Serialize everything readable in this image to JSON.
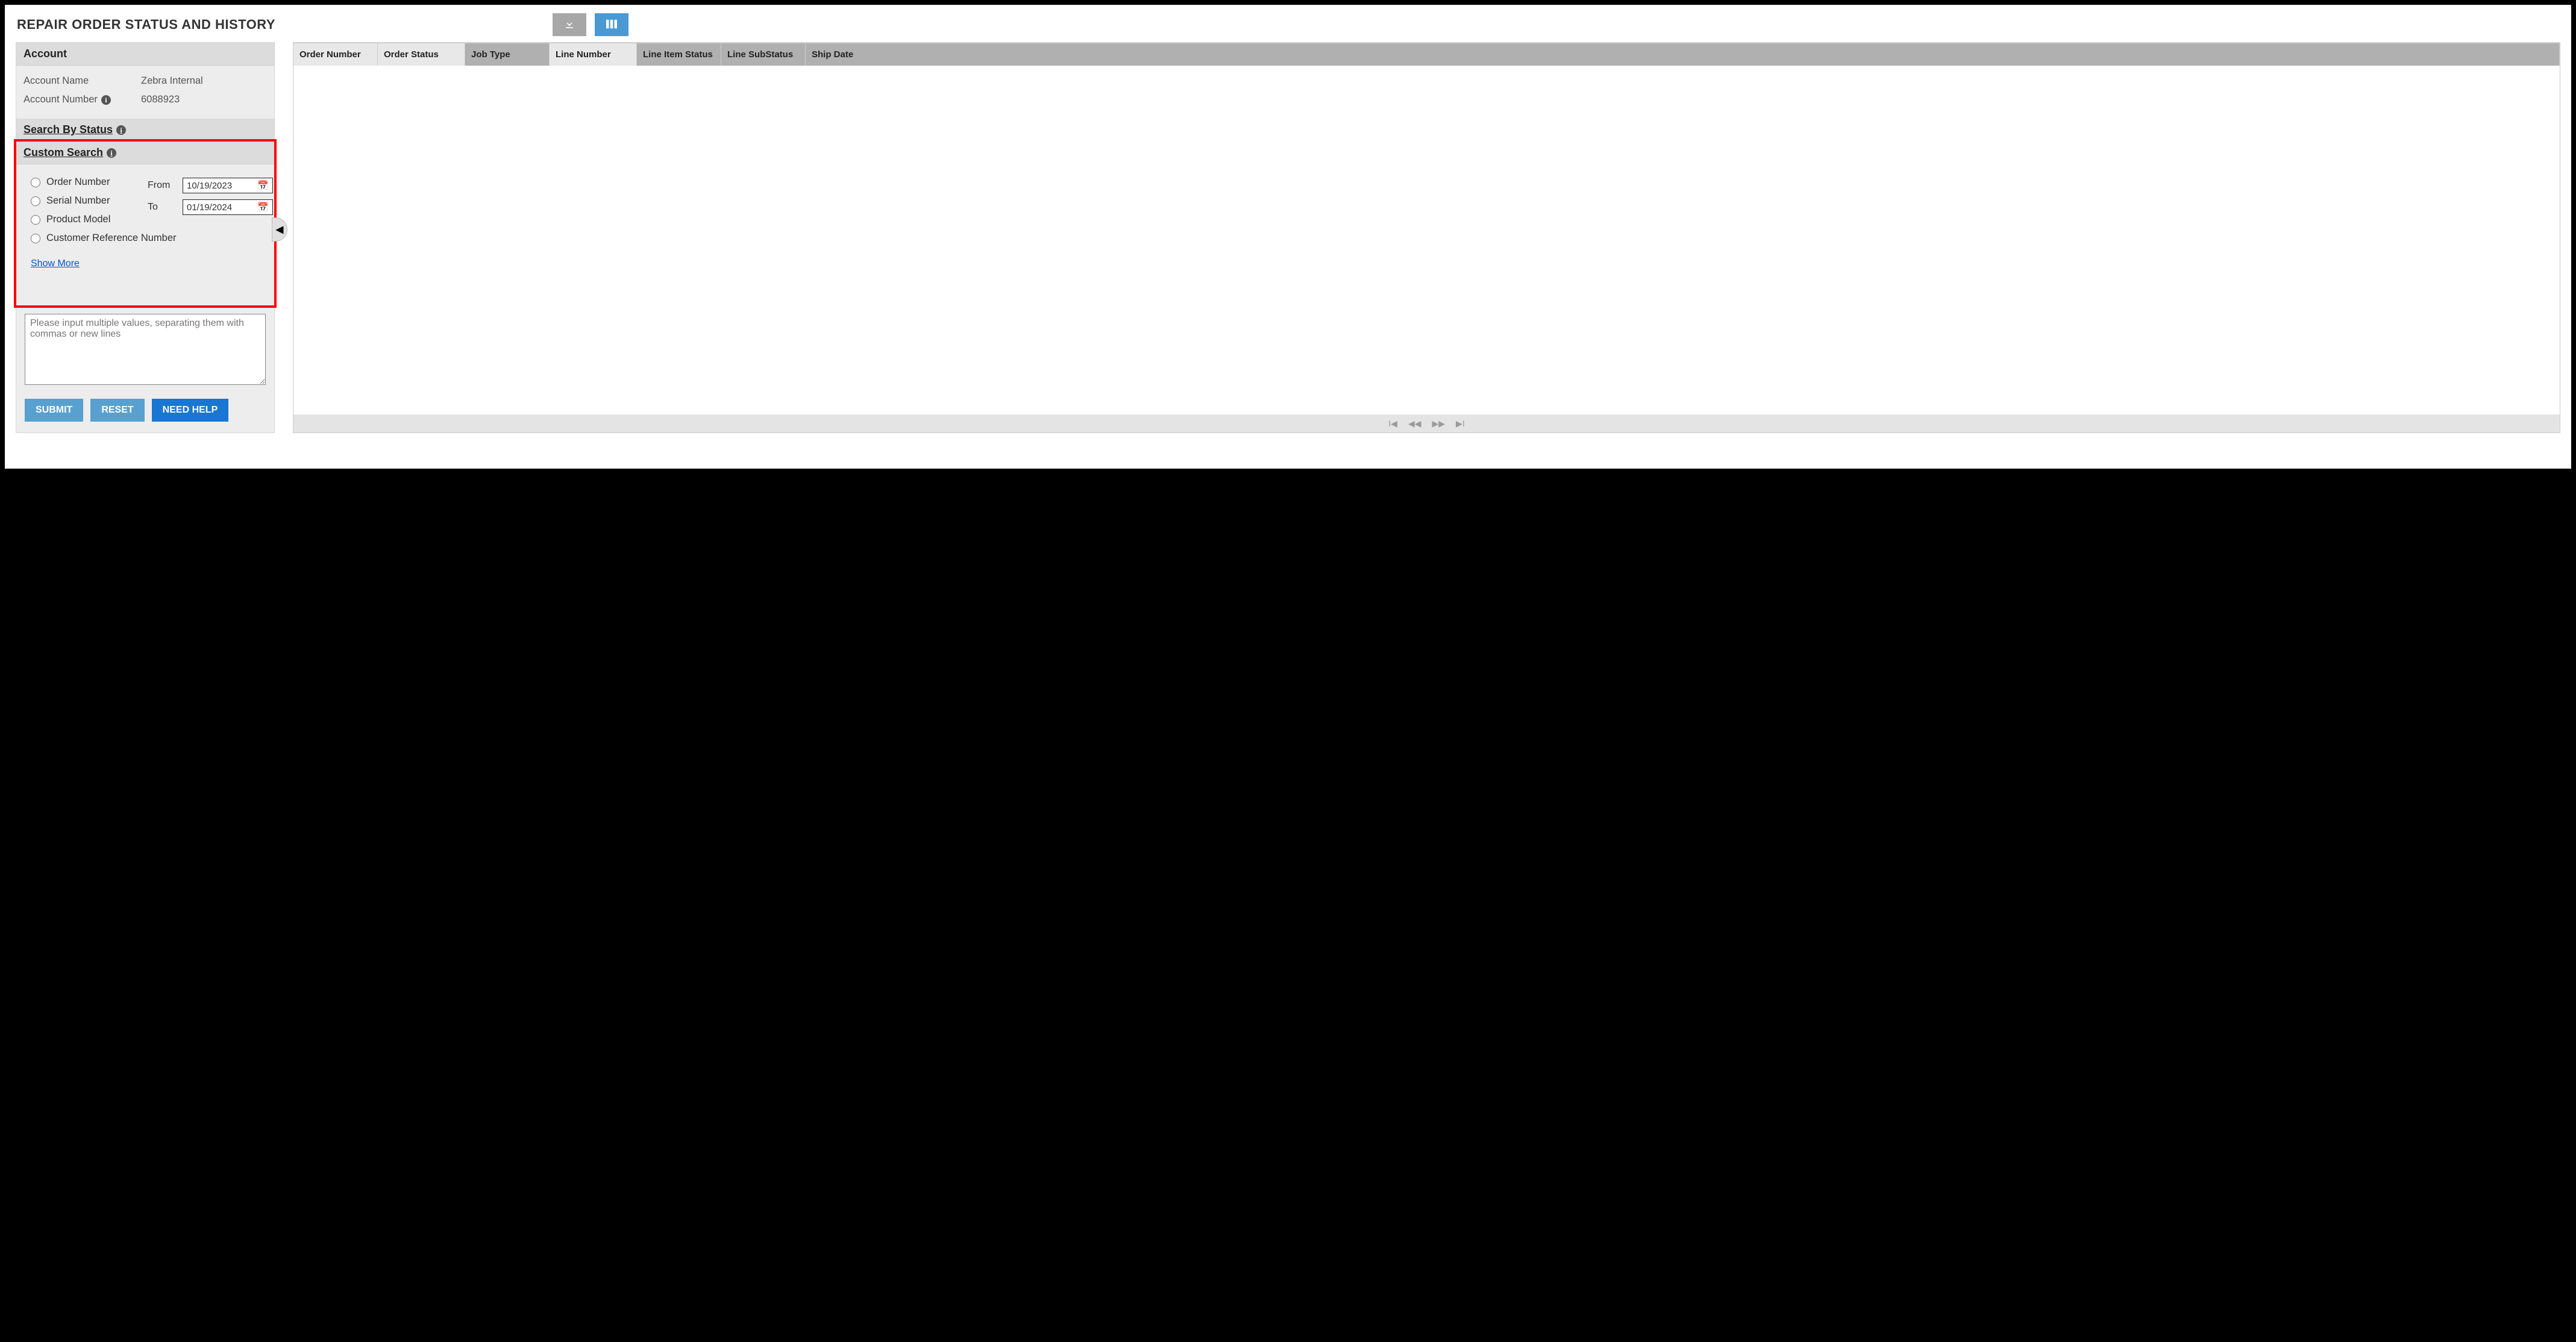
{
  "title": "REPAIR ORDER STATUS AND HISTORY",
  "account": {
    "header": "Account",
    "name_label": "Account Name",
    "name_value": "Zebra Internal",
    "number_label": "Account Number",
    "number_value": "6088923"
  },
  "search_by_status": {
    "header": "Search By Status"
  },
  "custom_search": {
    "header": "Custom Search",
    "options": {
      "order_number": "Order Number",
      "serial_number": "Serial Number",
      "product_model": "Product Model",
      "customer_ref": "Customer Reference Number"
    },
    "from_label": "From",
    "to_label": "To",
    "from_value": "10/19/2023",
    "to_value": "01/19/2024",
    "show_more": "Show More"
  },
  "multivalue_placeholder": "Please input multiple values, separating them with commas or new lines",
  "buttons": {
    "submit": "SUBMIT",
    "reset": "RESET",
    "need_help": "NEED HELP"
  },
  "table": {
    "headers": {
      "order_number": "Order Number",
      "order_status": "Order Status",
      "job_type": "Job Type",
      "line_number": "Line Number",
      "line_item_status": "Line Item Status",
      "line_substatus": "Line SubStatus",
      "ship_date": "Ship Date"
    }
  },
  "pager_glyphs": {
    "first": "⏮",
    "prev": "◀◀",
    "next": "▶▶",
    "last": "⏭"
  }
}
